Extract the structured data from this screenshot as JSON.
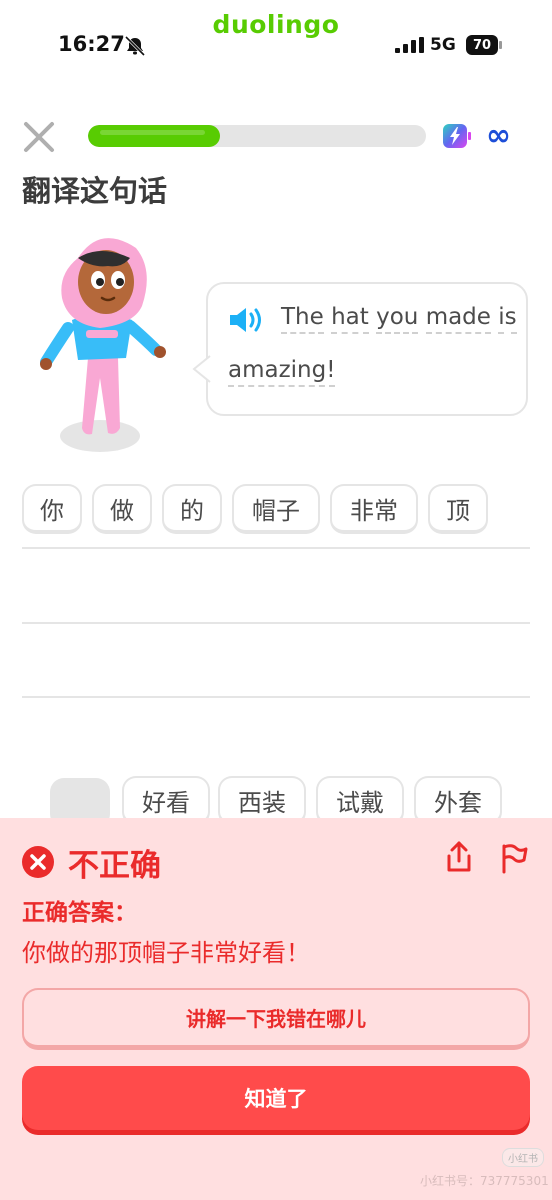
{
  "status_bar": {
    "brand": "duolingo",
    "time": "16:27",
    "network": "5G",
    "battery": "70"
  },
  "lesson": {
    "progress": 0.39,
    "infinity_symbol": "∞",
    "instruction": "翻译这句话",
    "sentence_line1": [
      "The",
      "hat",
      "you",
      "made",
      "is"
    ],
    "sentence_line2": [
      "amazing!"
    ]
  },
  "answer_tiles": [
    "你",
    "做",
    "的",
    "帽子",
    "非常",
    "顶"
  ],
  "word_bank_visible": [
    "好看",
    "西装",
    "试戴",
    "外套"
  ],
  "feedback": {
    "title": "不正确",
    "answer_label": "正确答案：",
    "correct_answer": "你做的那顶帽子非常好看！",
    "explain_button": "讲解一下我错在哪儿",
    "continue_button": "知道了"
  },
  "watermark": {
    "badge": "小红书",
    "text": "小红书号：737775301"
  },
  "colors": {
    "brand_green": "#58cc02",
    "error_red": "#ea2b2b",
    "error_bg": "#ffdfe0",
    "button_red": "#ff4b4b",
    "infinity_blue": "#1d4ed8",
    "speaker_blue": "#1cb0f6"
  },
  "icons": [
    "bell-muted-icon",
    "signal-icon",
    "battery-icon",
    "close-icon",
    "energy-icon",
    "speaker-icon",
    "error-x-icon",
    "share-icon",
    "report-flag-icon"
  ]
}
